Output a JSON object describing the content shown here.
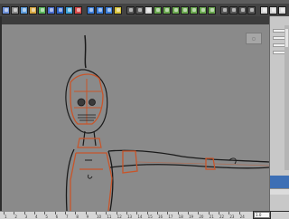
{
  "colors": {
    "viewport_bg": "#8a8a8a",
    "sketch_stroke": "#1a1a1a",
    "guide_stroke": "#c8552a",
    "ui_dark": "#434343",
    "side_panel": "#c8c8c8",
    "selection_blue": "#3d6fb5"
  },
  "shelf": {
    "tools": [
      {
        "icon": "select-icon",
        "color": "#6b8fd6"
      },
      {
        "icon": "lasso-icon",
        "color": "#8a8a8a"
      },
      {
        "icon": "paint-select-icon",
        "color": "#5c9bd9"
      },
      {
        "icon": "move-icon",
        "color": "#d6a640"
      },
      {
        "icon": "rotate-icon",
        "color": "#5cb85c"
      },
      {
        "icon": "scale-icon",
        "color": "#4a6fd0"
      },
      {
        "icon": "universal-manip-icon",
        "color": "#2f64c4"
      },
      {
        "icon": "soft-mod-icon",
        "color": "#3aa0d6"
      },
      {
        "icon": "show-manip-icon",
        "color": "#d64a4a"
      },
      {
        "icon": "snap-grid-icon",
        "color": "#3b7dd8"
      },
      {
        "icon": "snap-curve-icon",
        "color": "#3b7dd8"
      },
      {
        "icon": "snap-point-icon",
        "color": "#3b7dd8"
      },
      {
        "icon": "snap-view-icon",
        "color": "#d6c23a"
      },
      {
        "icon": "render-icon",
        "color": "#5a5a5a"
      },
      {
        "icon": "ipr-render-icon",
        "color": "#5a5a5a"
      },
      {
        "icon": "render-settings-icon",
        "color": "#d6d6d6"
      },
      {
        "icon": "hypershade-icon",
        "color": "#6aa84f"
      },
      {
        "icon": "graph-editor-icon",
        "color": "#6aa84f"
      },
      {
        "icon": "outliner-icon",
        "color": "#6aa84f"
      },
      {
        "icon": "curve-cv-icon",
        "color": "#6aa84f"
      },
      {
        "icon": "curve-ep-icon",
        "color": "#6aa84f"
      },
      {
        "icon": "pencil-curve-icon",
        "color": "#6aa84f"
      },
      {
        "icon": "arc-tool-icon",
        "color": "#6aa84f"
      },
      {
        "icon": "sphere-icon",
        "color": "#5a5a5a"
      },
      {
        "icon": "cube-icon",
        "color": "#5a5a5a"
      },
      {
        "icon": "cylinder-icon",
        "color": "#5a5a5a"
      },
      {
        "icon": "plane-icon",
        "color": "#5a5a5a"
      },
      {
        "icon": "layout-single-icon",
        "color": "#d6d6d6"
      },
      {
        "icon": "layout-four-icon",
        "color": "#d6d6d6"
      },
      {
        "icon": "layout-side-icon",
        "color": "#d6d6d6"
      }
    ]
  },
  "viewport": {
    "panel_menu": [
      "",
      "",
      "",
      "",
      ""
    ],
    "camera": "side-view"
  },
  "timeline": {
    "frames": [
      "1",
      "2",
      "3",
      "4",
      "5",
      "6",
      "7",
      "8",
      "9",
      "10",
      "11",
      "12",
      "13",
      "14",
      "15",
      "16",
      "17",
      "18",
      "19",
      "20",
      "21",
      "22",
      "23",
      "24"
    ],
    "current_frame": "1.0"
  }
}
